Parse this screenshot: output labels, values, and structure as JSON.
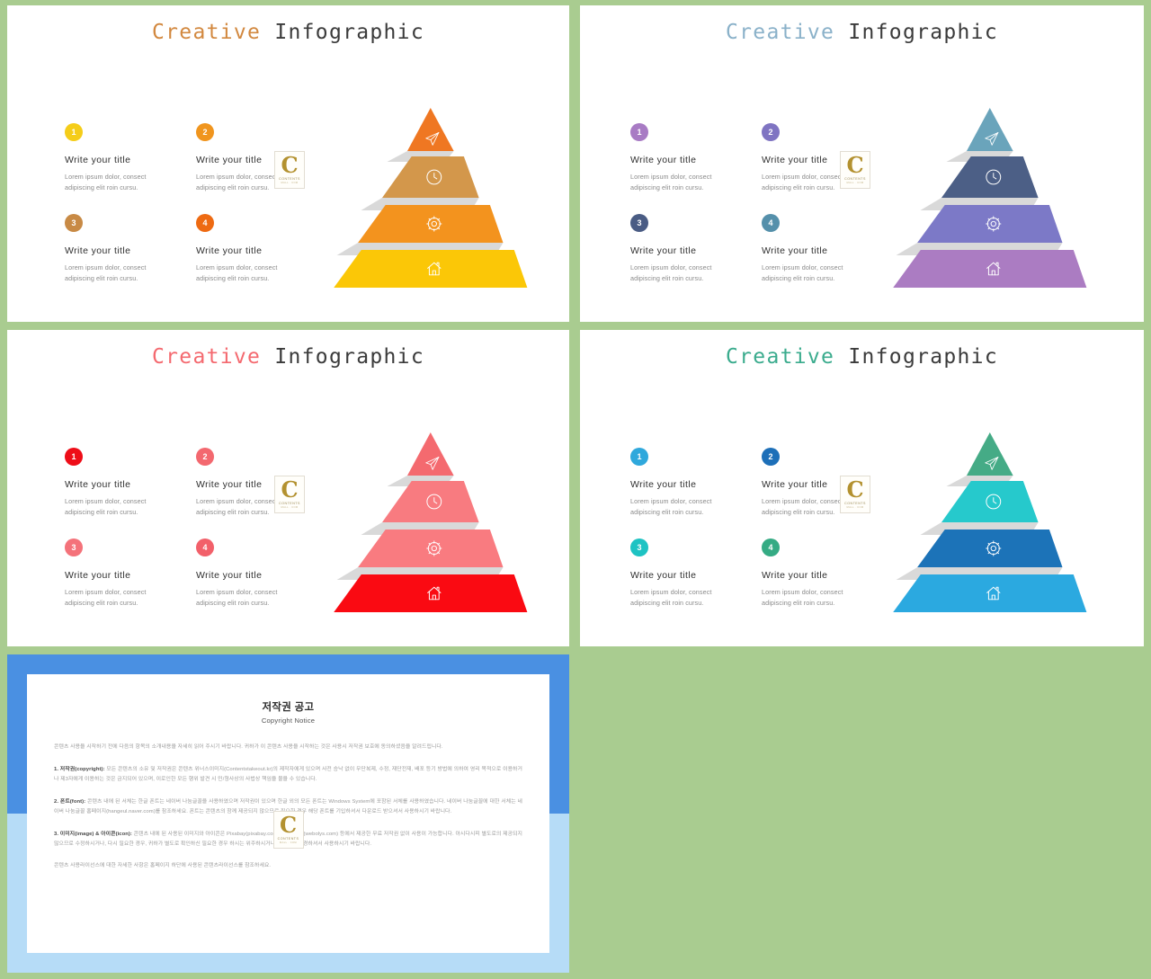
{
  "canvas": {
    "background_color": "#a9cc90"
  },
  "common": {
    "headline_accent": "Creative",
    "headline_main": " Infographic",
    "item_title": "Write your title",
    "item_body_line1": "Lorem ipsum dolor, consect",
    "item_body_line2": "adipiscing elit roin cursu.",
    "numbers": [
      "1",
      "2",
      "3",
      "4"
    ],
    "watermark": {
      "letter": "C",
      "line1": "CONTENTS",
      "line2": "MALL . COM"
    },
    "layer_icons": [
      "paper-plane-icon",
      "clock-icon",
      "gear-icon",
      "home-icon"
    ]
  },
  "slides": [
    {
      "id": "slide-orange",
      "headline_accent_color": "#d2883f",
      "headline_main_color": "#3b3b3b",
      "bullet_colors": [
        "#f5cd19",
        "#f0951e",
        "#c88a45",
        "#ee6a12"
      ],
      "pyramid_colors": [
        "#ef7722",
        "#d3974b",
        "#f3931e",
        "#fbc707"
      ],
      "shadow_color": "#d9d9d9"
    },
    {
      "id": "slide-blue-purple",
      "headline_accent_color": "#8ab1c9",
      "headline_main_color": "#3b3b3b",
      "bullet_colors": [
        "#a87bc4",
        "#7f74c2",
        "#4a5c84",
        "#5590ab"
      ],
      "pyramid_colors": [
        "#6aa4bb",
        "#4c5f86",
        "#7c79c7",
        "#ab7cc2"
      ],
      "shadow_color": "#d9d9d9"
    },
    {
      "id": "slide-red",
      "headline_accent_color": "#f4696f",
      "headline_main_color": "#3b3b3b",
      "bullet_colors": [
        "#ee0d18",
        "#f3686f",
        "#f4727a",
        "#f2606a"
      ],
      "pyramid_colors": [
        "#f46a6f",
        "#f87b80",
        "#f97b80",
        "#fa0a12"
      ],
      "shadow_color": "#d9d9d9"
    },
    {
      "id": "slide-teal-green",
      "headline_accent_color": "#3aab8d",
      "headline_main_color": "#3b3b3b",
      "bullet_colors": [
        "#2fa8dc",
        "#1d6fb8",
        "#1ec3c3",
        "#35ab84"
      ],
      "pyramid_colors": [
        "#45ab86",
        "#26c9cc",
        "#1c73b8",
        "#2ba9e0"
      ],
      "shadow_color": "#d9d9d9"
    }
  ],
  "copyright": {
    "frame_color_top": "#4a90e2",
    "frame_color_bottom": "#b6dcf7",
    "title_ko": "저작권 공고",
    "title_en": "Copyright Notice",
    "paragraph_lead": "콘텐츠 사용을 시작하기 전에 다음의 항목의 소개내용을 자세히 읽어 주시기 바랍니다. 귀하가 이 콘텐츠 사용을 시작하는 것은 사용시 저작권 보호에 동의하셨음을 알려드립니다.",
    "item1_label": "1. 저작권(copyright):",
    "item1_text": " 모든 콘텐츠의 소유 및 저작권은 콘텐츠 위너스이미지(Contentstakeout.kr)의 제작자에게 있으며 사전 승낙 없이 무단복제, 수정, 재단전재, 배포 등기 방법에 의하여 영리 목적으로 이용하거나 제3자에게 이용하는 것은 금지되어 있으며, 이로인한 모든 행위 발견 시 민/형사상의 사법상 책임을 물을 수 있습니다.",
    "item2_label": "2. 폰트(font):",
    "item2_text": " 콘텐츠 내에 된 서체는 한글 폰트는 네이버 나눔글꼴을 사용하였으며 저작권이 있으며 한글 외의 모든 폰트는 Windows System에 포함된 서체를 사용하였습니다. 네이버 나눔글꼴에 대한 서체는 네이버 나눔글꼴 홈페이지(hangeul.naver.com)를 참조하세요. 폰트는 콘텐츠의 함께 제공되지 않으므로 필요한 경우 해당 폰트를 기입하셔서 다운로드 받으셔서 사용하시기 바랍니다.",
    "item3_label": "3. 이미지(image) & 아이콘(icon):",
    "item3_text": " 콘텐츠 내에 된 사용된 이미지와 아이콘은 Pixabay(pixabay.com)와 Weboly(webolys.com) 등에서 제공한 무료 저작권 없이 사용이 가능합니다. 아시다시피 별도로의 제공되지 않으므로 수정하시거나, 다시 필요한 경우, 귀하가 별도로 확인하신 필요한 경우 하시는 위주하시거나 이미지를 변경하셔서 사용하시기 바랍니다.",
    "footer_text": "콘텐츠 사용라이선스에 대한 자세한 사항은 홈페이지 하단에 사용된 콘텐츠라이선스를 참조하세요."
  }
}
